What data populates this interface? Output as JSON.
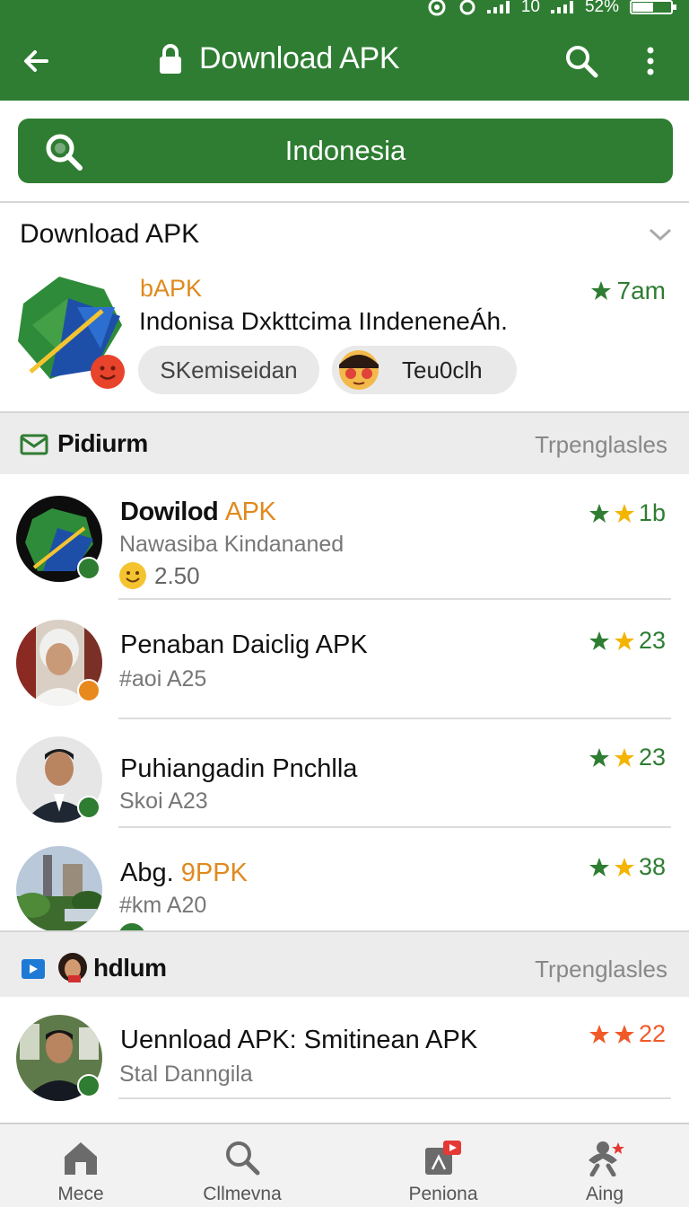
{
  "status_bar": {
    "network": "10",
    "battery": "52%",
    "battery_level": 0.52
  },
  "app_bar": {
    "title": "Download APK"
  },
  "search": {
    "value": "Indonesia"
  },
  "featured": {
    "header": "Download APK",
    "app_name": "bAPK",
    "description": "Indonisa Dxkttcima IIndeneneÁh.",
    "rating": "7am",
    "chips": [
      "SKemiseidan",
      "Teu0clh"
    ]
  },
  "sections": [
    {
      "title": "Pidiurm",
      "link": "Trpenglasles",
      "icon": "mail-icon"
    },
    {
      "title": "hdlum",
      "link": "Trpenglasles",
      "icon": "play-store-icon"
    }
  ],
  "list1": [
    {
      "name_main": "Dowilod",
      "name_accent": "APK",
      "sub": "Nawasiba Kindananed",
      "extra": "2.50",
      "rating": "1b",
      "badge_color": "#2e7d32"
    },
    {
      "name_main": "Penaban Daiclig APK",
      "name_accent": "",
      "sub": "#aoi A25",
      "rating": "23",
      "badge_color": "#e8891e"
    },
    {
      "name_main": "Puhiangadin Pnchlla",
      "name_accent": "",
      "sub": "Skoi A23",
      "rating": "23",
      "badge_color": "#2e7d32"
    },
    {
      "name_main": "Abg.",
      "name_accent": "9PPK",
      "sub": "#km A20",
      "rating": "38",
      "badge_color": "#2e7d32"
    }
  ],
  "list2": [
    {
      "name_main": "Uennload APK: Smitinean APK",
      "sub": "Stal Danngila",
      "rating": "22",
      "badge_color": "#2e7d32"
    }
  ],
  "bottom_nav": [
    {
      "label": "Mece",
      "icon": "home-icon"
    },
    {
      "label": "Cllmevna",
      "icon": "search-icon"
    },
    {
      "label": "Peniona",
      "icon": "video-icon"
    },
    {
      "label": "Aing",
      "icon": "profile-icon"
    }
  ],
  "colors": {
    "primary": "#2e7d32",
    "accent_orange": "#e08a1e",
    "star_yellow": "#f4b400",
    "star_red": "#f05a28"
  }
}
